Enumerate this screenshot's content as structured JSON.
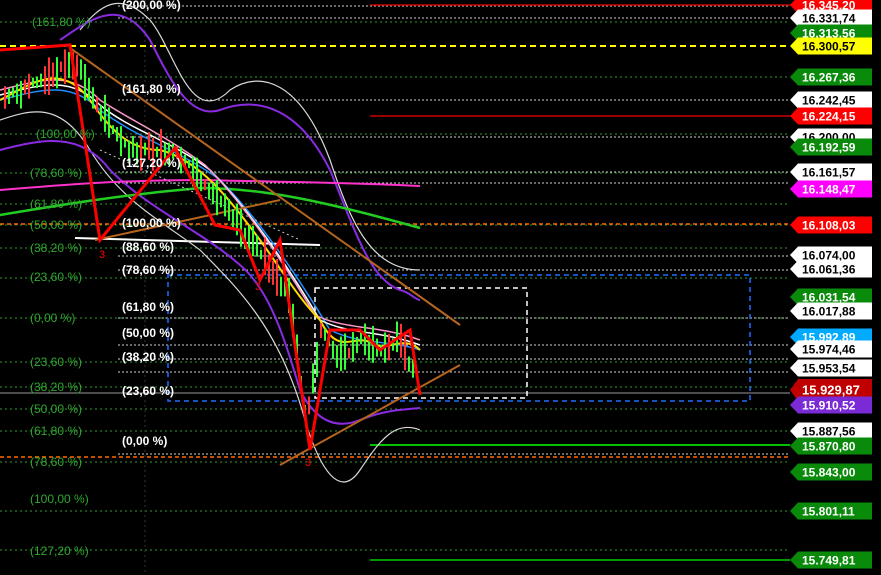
{
  "chart_data": {
    "type": "line",
    "ylim": [
      15725,
      16350
    ],
    "price_axis": [
      {
        "value": "16.345,20",
        "bg": "#ff0000",
        "fg": "#ffffff"
      },
      {
        "value": "16.331,74",
        "bg": "#ffffff",
        "fg": "#000000"
      },
      {
        "value": "16.313,56",
        "bg": "#0a8a0a",
        "fg": "#ffffff"
      },
      {
        "value": "16.300,57",
        "bg": "#ffff00",
        "fg": "#000000"
      },
      {
        "value": "16.267,36",
        "bg": "#0a8a0a",
        "fg": "#ffffff"
      },
      {
        "value": "16.242,45",
        "bg": "#ffffff",
        "fg": "#000000"
      },
      {
        "value": "16.224,15",
        "bg": "#ff0000",
        "fg": "#ffffff"
      },
      {
        "value": "16.200,00",
        "bg": "#ffffff",
        "fg": "#000000"
      },
      {
        "value": "16.192,59",
        "bg": "#0a8a0a",
        "fg": "#ffffff"
      },
      {
        "value": "16.161,57",
        "bg": "#ffffff",
        "fg": "#000000"
      },
      {
        "value": "16.148,47",
        "bg": "#ff00ff",
        "fg": "#ffffff"
      },
      {
        "value": "16.108,03",
        "bg": "#ff0000",
        "fg": "#ffffff"
      },
      {
        "value": "16.074,00",
        "bg": "#ffffff",
        "fg": "#000000"
      },
      {
        "value": "16.061,36",
        "bg": "#ffffff",
        "fg": "#000000"
      },
      {
        "value": "16.031,54",
        "bg": "#0a8a0a",
        "fg": "#ffffff"
      },
      {
        "value": "16.017,88",
        "bg": "#ffffff",
        "fg": "#000000"
      },
      {
        "value": "15.992,89",
        "bg": "#00aaff",
        "fg": "#ffffff"
      },
      {
        "value": "15.974,46",
        "bg": "#ffffff",
        "fg": "#000000"
      },
      {
        "value": "15.953,54",
        "bg": "#ffffff",
        "fg": "#000000"
      },
      {
        "value": "15.929,87",
        "bg": "#c00000",
        "fg": "#ffffff"
      },
      {
        "value": "15.910,52",
        "bg": "#7a2bd6",
        "fg": "#ffffff"
      },
      {
        "value": "15.887,56",
        "bg": "#ffffff",
        "fg": "#000000"
      },
      {
        "value": "15.870,80",
        "bg": "#0a8a0a",
        "fg": "#ffffff"
      },
      {
        "value": "15.843,00",
        "bg": "#0a8a0a",
        "fg": "#ffffff"
      },
      {
        "value": "15.801,11",
        "bg": "#0a8a0a",
        "fg": "#ffffff"
      },
      {
        "value": "15.749,81",
        "bg": "#0a8a0a",
        "fg": "#ffffff"
      }
    ],
    "fib_left": [
      "(161,80 %)",
      "(100,00 %)",
      "(78,60 %)",
      "(61,80 %)",
      "(50,00 %)",
      "(38,20 %)",
      "(23,60 %)",
      "(0,00 %)",
      "(23,60 %)",
      "(38,20 %)",
      "(50,00 %)",
      "(61,80 %)",
      "(78,60 %)",
      "(100,00 %)",
      "(127,20 %)"
    ],
    "fib_right": [
      "(200,00 %)",
      "(161,80 %)",
      "(127,20 %)",
      "(100,00 %)",
      "(88,60 %)",
      "(78,60 %)",
      "(61,80 %)",
      "(50,00 %)",
      "(38,20 %)",
      "(23,60 %)",
      "(0,00 %)"
    ],
    "annotations": [
      "3",
      "3",
      "3"
    ],
    "colors": {
      "background": "#000000",
      "candle_up": "#33ff33",
      "zigzag": "#ff0000",
      "bollinger": "#d9d9d9",
      "envelope": "#8a2be2",
      "ma_magenta": "#ff33cc",
      "ma_green": "#22cc22",
      "ma_yellow": "#ffd700",
      "ma_white": "#ffffff",
      "ma_pink": "#ff99cc",
      "ma_cyan": "#1e90ff",
      "trendline": "#b5651d",
      "fib_dotted": "#33aa33",
      "box_blue": "#1e6fff",
      "box_white": "#ffffff"
    }
  }
}
